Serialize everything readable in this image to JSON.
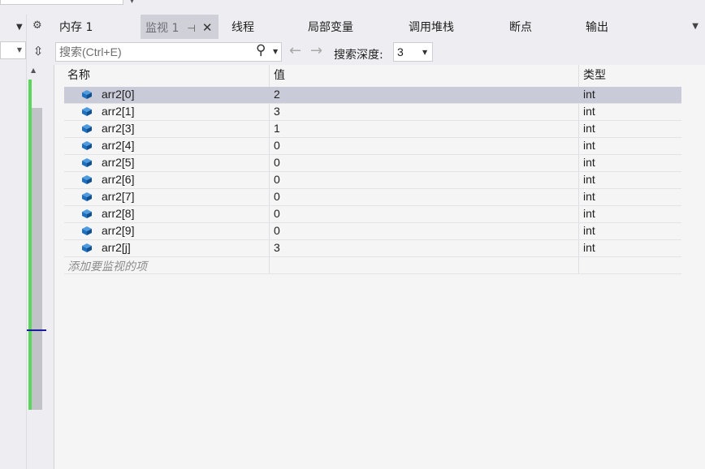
{
  "tabs": [
    {
      "label": "内存 1"
    },
    {
      "label": "监视 1",
      "active": true
    },
    {
      "label": "线程"
    },
    {
      "label": "局部变量"
    },
    {
      "label": "调用堆栈"
    },
    {
      "label": "断点"
    },
    {
      "label": "输出"
    }
  ],
  "toolbar": {
    "search_placeholder": "搜索(Ctrl+E)",
    "depth_label": "搜索深度:",
    "depth_value": "3"
  },
  "columns": {
    "name": "名称",
    "value": "值",
    "type": "类型"
  },
  "rows": [
    {
      "name": "arr2[0]",
      "value": "2",
      "type": "int"
    },
    {
      "name": "arr2[1]",
      "value": "3",
      "type": "int"
    },
    {
      "name": "arr2[3]",
      "value": "1",
      "type": "int"
    },
    {
      "name": "arr2[4]",
      "value": "0",
      "type": "int"
    },
    {
      "name": "arr2[5]",
      "value": "0",
      "type": "int"
    },
    {
      "name": "arr2[6]",
      "value": "0",
      "type": "int"
    },
    {
      "name": "arr2[7]",
      "value": "0",
      "type": "int"
    },
    {
      "name": "arr2[8]",
      "value": "0",
      "type": "int"
    },
    {
      "name": "arr2[9]",
      "value": "0",
      "type": "int"
    },
    {
      "name": "arr2[j]",
      "value": "3",
      "type": "int"
    }
  ],
  "add_item_placeholder": "添加要监视的项",
  "icons": {
    "field": "variable-cube-icon",
    "pin": "pin-icon",
    "close": "close-icon",
    "search": "search-icon",
    "back": "arrow-left-icon",
    "forward": "arrow-right-icon",
    "gear": "gear-icon"
  },
  "colors": {
    "selected_row": "#c9cbd8",
    "active_tab": "#cfd0d8",
    "icon_blue": "#1e6fbf",
    "scroll_green": "#5ad65a"
  }
}
